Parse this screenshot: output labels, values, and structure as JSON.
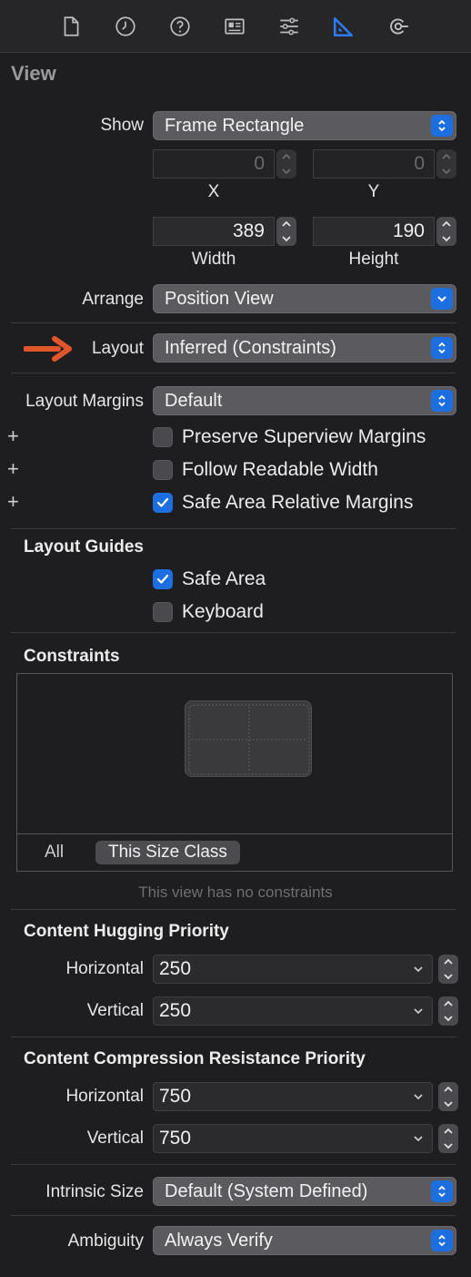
{
  "toolbar": {
    "icons": [
      "file-icon",
      "history-icon",
      "help-icon",
      "identity-icon",
      "attributes-icon",
      "size-ruler-icon",
      "connections-icon"
    ]
  },
  "view": {
    "title": "View",
    "show_label": "Show",
    "show_value": "Frame Rectangle",
    "x_value": "0",
    "y_value": "0",
    "x_label": "X",
    "y_label": "Y",
    "width_value": "389",
    "height_value": "190",
    "width_label": "Width",
    "height_label": "Height",
    "arrange_label": "Arrange",
    "arrange_value": "Position View",
    "layout_label": "Layout",
    "layout_value": "Inferred (Constraints)",
    "layout_margins_label": "Layout Margins",
    "layout_margins_value": "Default",
    "preserve_superview_margins": "Preserve Superview Margins",
    "follow_readable_width": "Follow Readable Width",
    "safe_area_relative_margins": "Safe Area Relative Margins"
  },
  "layout_guides": {
    "title": "Layout Guides",
    "safe_area": "Safe Area",
    "keyboard": "Keyboard"
  },
  "constraints": {
    "title": "Constraints",
    "tab_all": "All",
    "tab_size_class": "This Size Class",
    "empty_message": "This view has no constraints"
  },
  "hugging": {
    "title": "Content Hugging Priority",
    "horizontal_label": "Horizontal",
    "horizontal_value": "250",
    "vertical_label": "Vertical",
    "vertical_value": "250"
  },
  "compression": {
    "title": "Content Compression Resistance Priority",
    "horizontal_label": "Horizontal",
    "horizontal_value": "750",
    "vertical_label": "Vertical",
    "vertical_value": "750"
  },
  "intrinsic": {
    "label": "Intrinsic Size",
    "value": "Default (System Defined)"
  },
  "ambiguity": {
    "label": "Ambiguity",
    "value": "Always Verify"
  },
  "colors": {
    "accent": "#1d6fe0",
    "arrow": "#e0552a",
    "background": "#1e1e20"
  }
}
